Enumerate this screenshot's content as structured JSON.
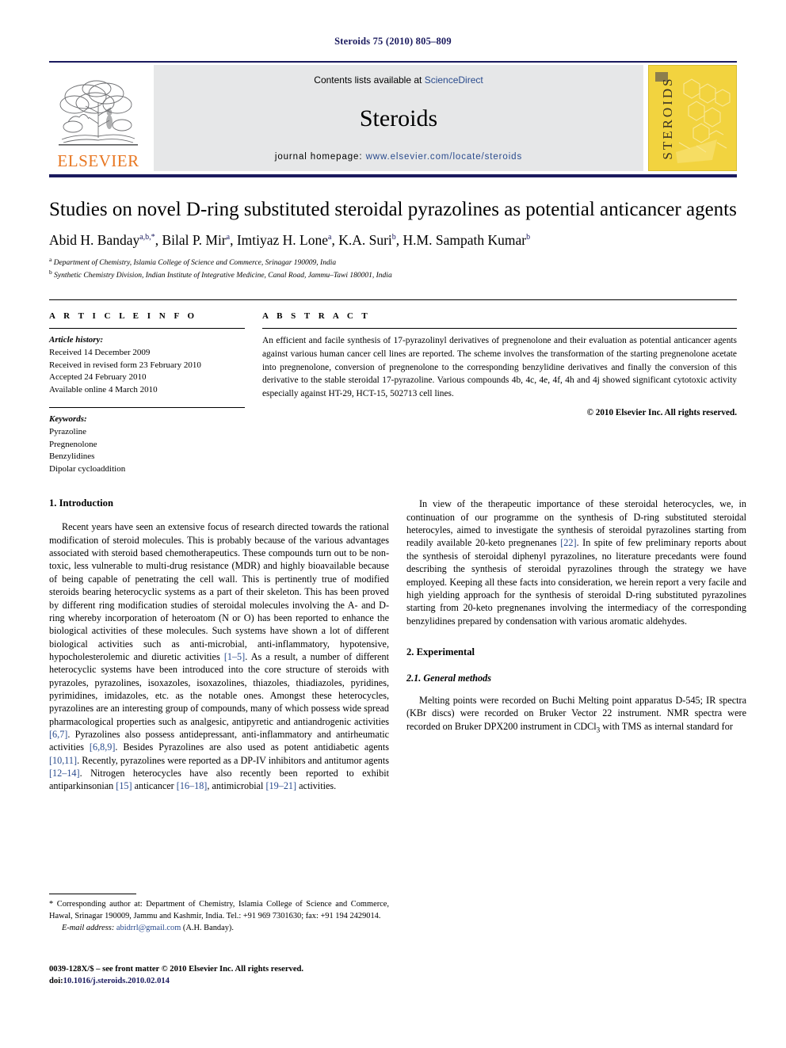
{
  "running_head": "Steroids 75 (2010) 805–809",
  "masthead": {
    "publisher_name": "ELSEVIER",
    "contents_prefix": "Contents lists available at ",
    "contents_link": "ScienceDirect",
    "journal_name": "Steroids",
    "homepage_prefix": "journal homepage: ",
    "homepage_url": "www.elsevier.com/locate/steroids",
    "cover_title": "STEROIDS",
    "link_color": "#2a4b8d",
    "band_color": "#e6e7e8",
    "cover_color": "#f2d33f",
    "elsevier_orange": "#E87722"
  },
  "article": {
    "title": "Studies on novel D-ring substituted steroidal pyrazolines as potential anticancer agents",
    "authors_html": "Abid H. Banday<sup>a,b,*</sup>, Bilal P. Mir<sup>a</sup>, Imtiyaz H. Lone<sup>a</sup>, K.A. Suri<sup>b</sup>, H.M. Sampath Kumar<sup>b</sup>",
    "affiliations": [
      "Department of Chemistry, Islamia College of Science and Commerce, Srinagar 190009, India",
      "Synthetic Chemistry Division, Indian Institute of Integrative Medicine, Canal Road, Jammu–Tawi 180001, India"
    ],
    "affiliation_marks": [
      "a",
      "b"
    ]
  },
  "article_info": {
    "heading": "A R T I C L E  I N F O",
    "history_label": "Article history:",
    "history": [
      "Received 14 December 2009",
      "Received in revised form 23 February 2010",
      "Accepted 24 February 2010",
      "Available online 4 March 2010"
    ],
    "keywords_label": "Keywords:",
    "keywords": [
      "Pyrazoline",
      "Pregnenolone",
      "Benzylidines",
      "Dipolar cycloaddition"
    ]
  },
  "abstract": {
    "heading": "A B S T R A C T",
    "text": "An efficient and facile synthesis of 17-pyrazolinyl derivatives of pregnenolone and their evaluation as potential anticancer agents against various human cancer cell lines are reported. The scheme involves the transformation of the starting pregnenolone acetate into pregnenolone, conversion of pregnenolone to the corresponding benzylidine derivatives and finally the conversion of this derivative to the stable steroidal 17-pyrazoline. Various compounds 4b, 4c, 4e, 4f, 4h and 4j showed significant cytotoxic activity especially against HT-29, HCT-15, 502713 cell lines.",
    "copyright": "© 2010 Elsevier Inc. All rights reserved."
  },
  "sections": {
    "introduction_heading": "1.  Introduction",
    "experimental_heading": "2.  Experimental",
    "general_methods_heading": "2.1.  General methods"
  },
  "body": {
    "intro_p1_a": "Recent years have seen an extensive focus of research directed towards the rational modification of steroid molecules. This is probably because of the various advantages associated with steroid based chemotherapeutics. These compounds turn out to be non-toxic, less vulnerable to multi-drug resistance (MDR) and highly bioavailable because of being capable of penetrating the cell wall. This is pertinently true of modified steroids bearing heterocyclic systems as a part of their skeleton. This has been proved by different ring modification studies of steroidal molecules involving the A- and D-ring whereby incorporation of heteroatom (N or O) has been reported to enhance the biological activities of these molecules. Such systems have shown a lot of different biological activities such as anti-microbial, anti-inflammatory, hypotensive, hypocholesterolemic and diuretic activities ",
    "ref_1_5": "[1–5]",
    "intro_p1_b": ". As a result, a number of different heterocyclic systems have been introduced into the core structure of steroids with pyrazoles, pyrazolines, isoxazoles, isoxazolines, thiazoles, thiadiazoles, pyridines, pyrimidines, imidazoles, etc. as the notable ones. Amongst these heterocycles, pyrazolines are an interesting group of compounds, many of which possess wide spread pharmacological properties such as analgesic, antipyretic and antiandrogenic activities ",
    "ref_6_7": "[6,7]",
    "intro_p1_c": ". Pyrazolines also possess antidepressant, anti-inflammatory and antirheumatic activities ",
    "ref_6_8_9": "[6,8,9]",
    "intro_p1_d": ". Besides Pyrazolines are also used as potent antidiabetic agents ",
    "ref_10_11": "[10,11]",
    "intro_p1_e": ". Recently, pyrazolines were reported as a DP-IV inhibitors and antitumor agents ",
    "ref_12_14": "[12–14]",
    "intro_p1_f": ". Nitrogen heterocycles have also recently been reported to exhibit antiparkinsonian ",
    "ref_15": "[15]",
    "intro_p1_g": " anticancer ",
    "ref_16_18": "[16–18]",
    "intro_p1_h": ", antimicrobial ",
    "ref_19_21": "[19–21]",
    "intro_p1_i": " activities.",
    "intro_p2_a": "In view of the therapeutic importance of these steroidal heterocycles, we, in continuation of our programme on the synthesis of D-ring substituted steroidal heterocyles, aimed to investigate the synthesis of steroidal pyrazolines starting from readily available 20-keto pregnenanes ",
    "ref_22": "[22]",
    "intro_p2_b": ". In spite of few preliminary reports about the synthesis of steroidal diphenyl pyrazolines, no literature precedants were found describing the synthesis of steroidal pyrazolines through the strategy we have employed. Keeping all these facts into consideration, we herein report a very facile and high yielding approach for the synthesis of steroidal D-ring substituted pyrazolines starting from 20-keto pregnenanes involving the intermediacy of the corresponding benzylidines prepared by condensation with various aromatic aldehydes.",
    "methods_p1_a": "Melting points were recorded on Buchi Melting point apparatus D-545; IR spectra (KBr discs) were recorded on Bruker Vector 22 instrument. NMR spectra were recorded on Bruker DPX200 instrument in CDCl",
    "methods_sub": "3",
    "methods_p1_b": " with TMS as internal standard for"
  },
  "footnote": {
    "star_text": "* Corresponding author at: Department of Chemistry, Islamia College of Science and Commerce, Hawal, Srinagar 190009, Jammu and Kashmir, India. Tel.: +91 969 7301630; fax: +91 194 2429014.",
    "email_label": "E-mail address:",
    "email": "abidrrl@gmail.com",
    "email_owner": "(A.H. Banday)."
  },
  "imprint": {
    "issn_line": "0039-128X/$ – see front matter © 2010 Elsevier Inc. All rights reserved.",
    "doi_prefix": "doi:",
    "doi": "10.1016/j.steroids.2010.02.014"
  }
}
